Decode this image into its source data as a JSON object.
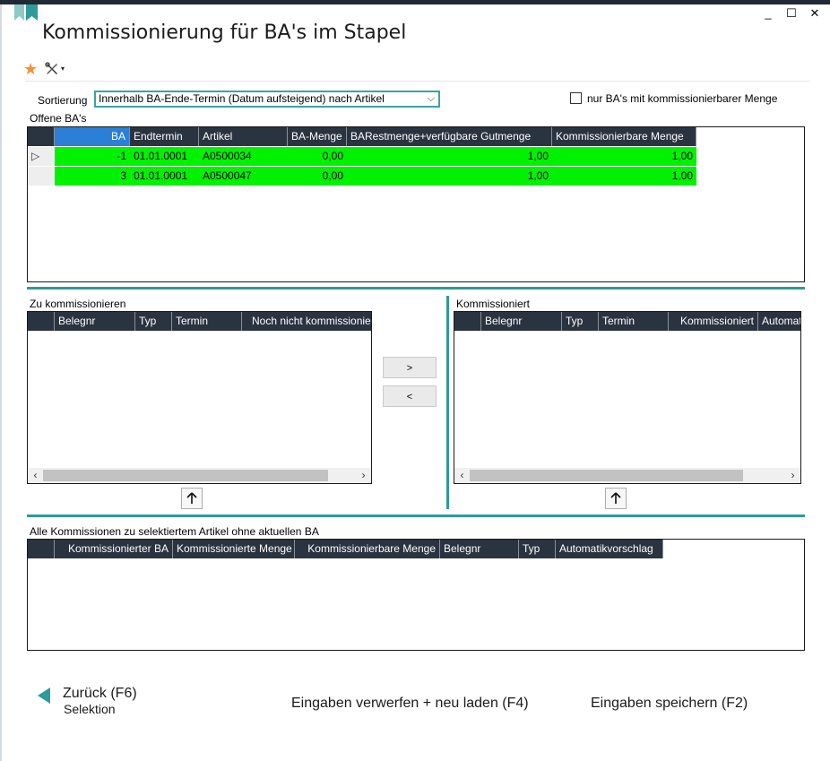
{
  "window": {
    "title": "Kommissionierung für BA's im Stapel",
    "controls": {
      "minimize": "_",
      "maximize": "☐",
      "close": "✕"
    }
  },
  "toolbar": {
    "favorite_icon": "star-icon",
    "tools_icon": "tools-icon",
    "tools_caret": "▾"
  },
  "sort": {
    "label": "Sortierung",
    "value": "Innerhalb BA-Ende-Termin (Datum aufsteigend) nach Artikel",
    "arrow": "⌵"
  },
  "filter": {
    "label": "nur BA's mit kommissionierbarer Menge",
    "checked": false
  },
  "open_ba": {
    "label": "Offene BA's",
    "columns": [
      "BA",
      "Endtermin",
      "Artikel",
      "BA-Menge",
      "BARestmenge+verfügbare Gutmenge",
      "Kommissionierbare Menge"
    ],
    "rows": [
      {
        "indicator": "▷",
        "cells": [
          "-1",
          "01.01.0001",
          "A0500034",
          "0,00",
          "1,00",
          "1,00"
        ]
      },
      {
        "indicator": "",
        "cells": [
          "3",
          "01.01.0001",
          "A0500047",
          "0,00",
          "1,00",
          "1,00"
        ]
      }
    ]
  },
  "to_pick": {
    "label": "Zu kommissionieren",
    "columns": [
      "Belegnr",
      "Typ",
      "Termin",
      "Noch nicht kommissioniert"
    ]
  },
  "picked": {
    "label": "Kommissioniert",
    "columns": [
      "Belegnr",
      "Typ",
      "Termin",
      "Kommissioniert",
      "Automatikvorschlag"
    ]
  },
  "transfer": {
    "add": ">",
    "remove": "<",
    "up": "🡡"
  },
  "all_picks": {
    "label": "Alle Kommissionen zu selektiertem Artikel ohne aktuellen BA",
    "columns": [
      "Kommissionierter BA",
      "Kommissionierte Menge",
      "Kommissionierbare Menge",
      "Belegnr",
      "Typ",
      "Automatikvorschlag"
    ]
  },
  "footer": {
    "back_label": "Zurück (F6)",
    "back_sub": "Selektion",
    "discard_label": "Eingaben verwerfen + neu laden (F4)",
    "save_label": "Eingaben speichern (F2)"
  },
  "colors": {
    "accent": "#2d9a9b",
    "header": "#2a3340",
    "highlight_row": "#00f200",
    "star": "#f0913a"
  }
}
